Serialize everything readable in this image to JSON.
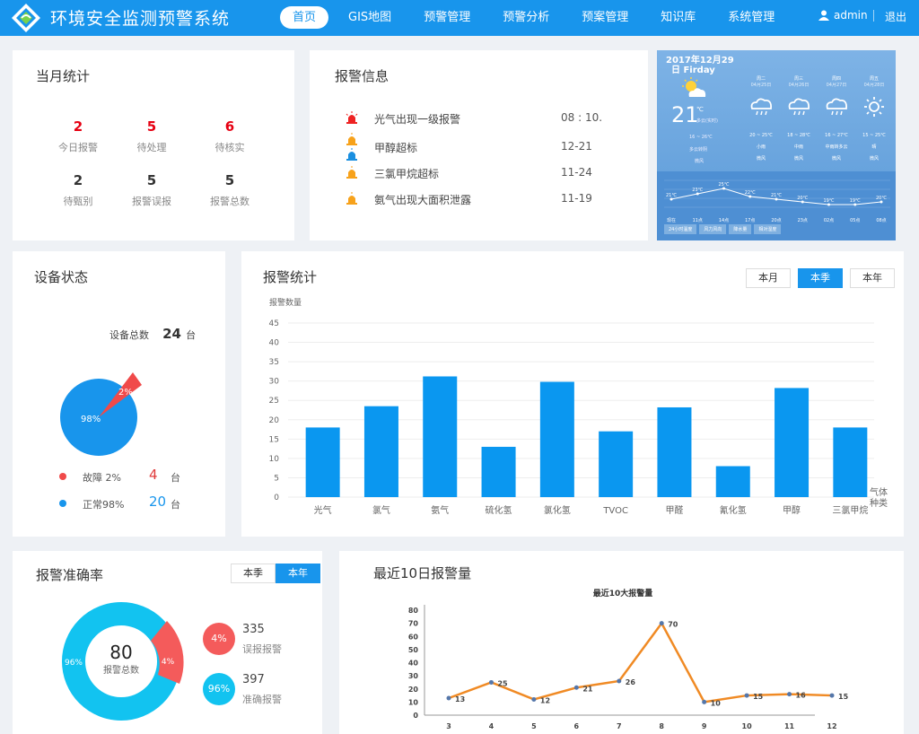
{
  "header": {
    "app_title": "环境安全监测预警系统",
    "nav": [
      "首页",
      "GIS地图",
      "预警管理",
      "预警分析",
      "预案管理",
      "知识库",
      "系统管理"
    ],
    "active_nav": "首页",
    "user": "admin",
    "logout": "退出"
  },
  "monthly": {
    "title": "当月统计",
    "stats": [
      {
        "value": "2",
        "label": "今日报警",
        "color": "red"
      },
      {
        "value": "5",
        "label": "待处理",
        "color": "red"
      },
      {
        "value": "6",
        "label": "待核实",
        "color": "red"
      },
      {
        "value": "2",
        "label": "待甄别",
        "color": "dark"
      },
      {
        "value": "5",
        "label": "报警误报",
        "color": "dark"
      },
      {
        "value": "5",
        "label": "报警总数",
        "color": "dark"
      }
    ]
  },
  "alarms": {
    "title": "报警信息",
    "items": [
      {
        "text": "光气出现一级报警",
        "date": "08 : 10.",
        "icon": "red-siren-icon"
      },
      {
        "text": "甲醇超标",
        "date": "12-21",
        "icon": "blue-siren-icon"
      },
      {
        "text": "三氯甲烷超标",
        "date": "11-24",
        "icon": "orange-siren-icon"
      },
      {
        "text": "氨气出现大面积泄露",
        "date": "11-19",
        "icon": "orange-siren-icon"
      }
    ]
  },
  "weather": {
    "date": "2017年12月29",
    "weekday": "日 Firday",
    "temp": "21",
    "unit": "℃",
    "current_desc": "多云(实时)",
    "today_range": "16 ~ 26℃",
    "today_desc": "多云转阴",
    "today_wind": "微风",
    "days": [
      {
        "name": "周二",
        "date": "04月25日",
        "range": "20 ~ 25℃",
        "desc": "小雨",
        "wind": "微风"
      },
      {
        "name": "周三",
        "date": "04月26日",
        "range": "18 ~ 28℃",
        "desc": "中雨",
        "wind": "微风"
      },
      {
        "name": "周四",
        "date": "04月27日",
        "range": "16 ~ 27℃",
        "desc": "中雨转多云",
        "wind": "微风"
      },
      {
        "name": "周五",
        "date": "04月28日",
        "range": "15 ~ 25℃",
        "desc": "晴",
        "wind": "微风"
      }
    ],
    "hours": [
      "现在",
      "11点",
      "14点",
      "17点",
      "20点",
      "23点",
      "02点",
      "05点",
      "08点"
    ],
    "hour_temps": [
      "21℃",
      "23℃",
      "25℃",
      "22℃",
      "21℃",
      "20℃",
      "19℃",
      "19℃",
      "20℃"
    ],
    "tabs": [
      "24小时温度",
      "风力风向",
      "降水量",
      "相对湿度"
    ]
  },
  "device": {
    "title": "设备状态",
    "total_label": "设备总数",
    "total": "24",
    "unit": "台",
    "fault_pct": "2%",
    "normal_pct": "98%",
    "fault_label": "故障 2%",
    "fault_count": "4",
    "normal_label": "正常98%",
    "normal_count": "20",
    "colors": {
      "fault": "#f04a4a",
      "normal": "#1895ec"
    }
  },
  "alarm_stats": {
    "title": "报警统计",
    "buttons": [
      "本月",
      "本季",
      "本年"
    ],
    "active": "本季"
  },
  "accuracy": {
    "title": "报警准确率",
    "buttons": [
      "本季",
      "本年"
    ],
    "active": "本年",
    "center_value": "80",
    "center_label": "报警总数",
    "ring_inner_pct": "96%",
    "ring_red_pct": "4%",
    "false_pct": "4%",
    "false_count": "335",
    "false_label": "误报报警",
    "true_pct": "96%",
    "true_count": "397",
    "true_label": "准确报警",
    "colors": {
      "false": "#f45b5b",
      "true": "#12c3f0"
    }
  },
  "recent": {
    "title": "最近10日报警量"
  },
  "chart_data": [
    {
      "type": "bar",
      "title": "",
      "ylabel": "报警数量",
      "xlabel": "气体种类",
      "categories": [
        "光气",
        "氯气",
        "氨气",
        "硫化氢",
        "氯化氢",
        "TVOC",
        "甲醛",
        "氰化氢",
        "甲醇",
        "三氯甲烷"
      ],
      "values": [
        18,
        23.5,
        31.2,
        13,
        29.8,
        17,
        23.2,
        8,
        28.2,
        18
      ],
      "yticks": [
        0,
        5,
        10,
        15,
        20,
        25,
        30,
        35,
        40,
        45
      ],
      "ylim": [
        0,
        45
      ],
      "color": "#0a97f0"
    },
    {
      "type": "line",
      "title": "最近10大报警量",
      "x": [
        3,
        4,
        5,
        6,
        7,
        8,
        9,
        10,
        11,
        12
      ],
      "values": [
        13,
        25,
        12,
        21,
        26,
        70,
        10,
        15,
        16,
        15
      ],
      "labels": [
        "13",
        "25",
        "12",
        "21",
        "26",
        "70",
        "10",
        "15",
        "16",
        "15"
      ],
      "yticks": [
        0,
        10,
        20,
        30,
        40,
        50,
        60,
        70,
        80
      ],
      "ylim": [
        0,
        80
      ],
      "color": "#f08a24"
    }
  ]
}
